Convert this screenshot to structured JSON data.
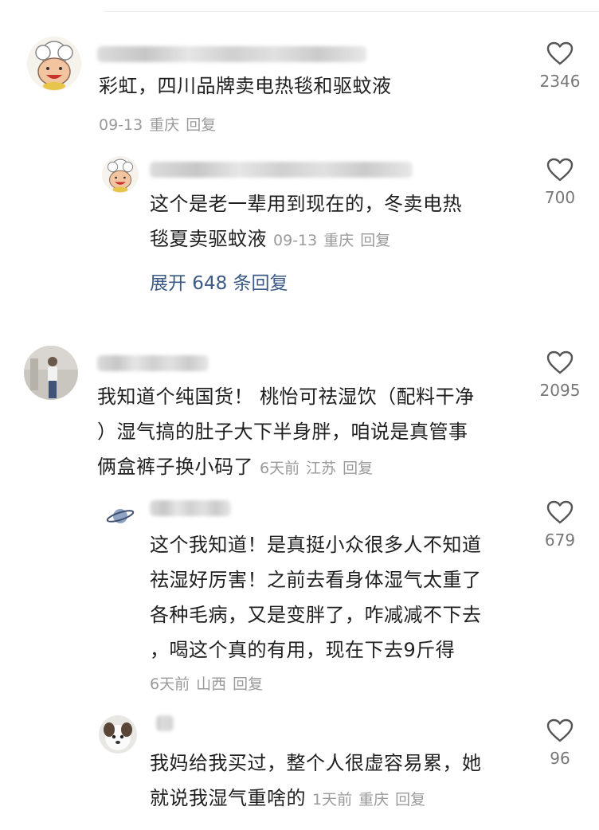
{
  "comments": [
    {
      "text": "彩虹，四川品牌卖电热毯和驱蚊液",
      "date": "09-13",
      "location": "重庆",
      "reply": "回复",
      "likes": "2346"
    },
    {
      "text1": "这个是老一辈用到现在的，冬卖电热",
      "text2": "毯夏卖驱蚊液",
      "date": "09-13",
      "location": "重庆",
      "reply": "回复",
      "likes": "700",
      "expand": "展开 648 条回复"
    },
    {
      "text1": "我知道个纯国货！ 桃怡可祛湿饮（配料干净",
      "text2": "）湿气搞的肚子大下半身胖，咱说是真管事",
      "text3": "俩盒裤子换小码了",
      "date": "6天前",
      "location": "江苏",
      "reply": "回复",
      "likes": "2095"
    },
    {
      "text1": "这个我知道！是真挺小众很多人不知道",
      "text2": "祛湿好厉害！之前去看身体湿气太重了",
      "text3": "各种毛病，又是变胖了，咋减减不下去",
      "text4": "，喝这个真的有用，现在下去9斤得",
      "date": "6天前",
      "location": "山西",
      "reply": "回复",
      "likes": "679"
    },
    {
      "text1": "我妈给我买过，整个人很虚容易累，她",
      "text2": "就说我湿气重啥的",
      "date": "1天前",
      "location": "重庆",
      "reply": "回复",
      "likes": "96"
    }
  ],
  "icons": {
    "like": "heart-outline-icon"
  },
  "colors": {
    "link": "#3b5a86",
    "meta": "#9a9a9a"
  }
}
